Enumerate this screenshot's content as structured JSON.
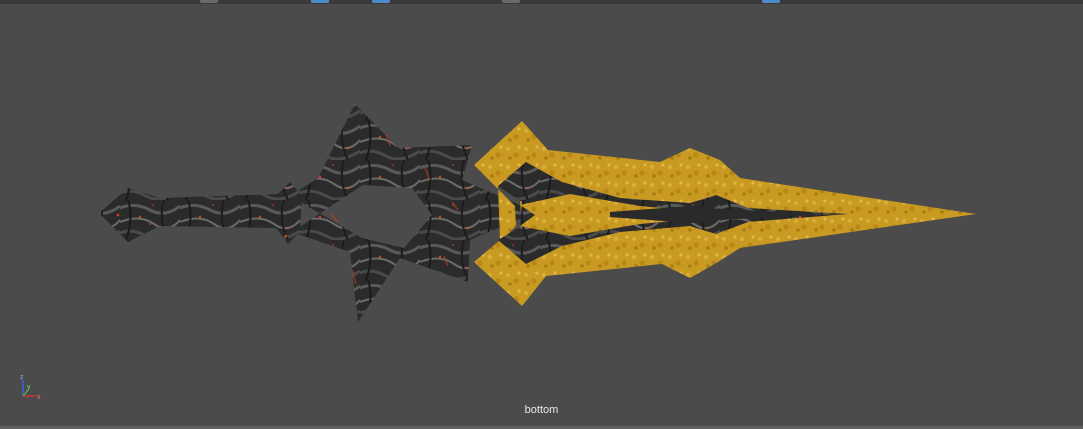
{
  "viewport": {
    "camera_label": "bottom",
    "background_color": "#4b4b4b",
    "object_texture_colors": {
      "dark_rock": "#2a2a2a",
      "lava_glow": "#c03a10",
      "gold": "#c99a22"
    }
  },
  "axis_gizmo": {
    "z_label": "z",
    "y_label": "y",
    "x_label": "x",
    "z_color": "#3a62ff",
    "y_color": "#40c040",
    "x_color": "#e03030"
  },
  "header_tabs": [
    {
      "color": "#6a6a6a"
    },
    {
      "color": "#4d8cc9"
    },
    {
      "color": "#4d8cc9"
    },
    {
      "color": "#6a6a6a"
    },
    {
      "color": "#4d8cc9"
    }
  ]
}
